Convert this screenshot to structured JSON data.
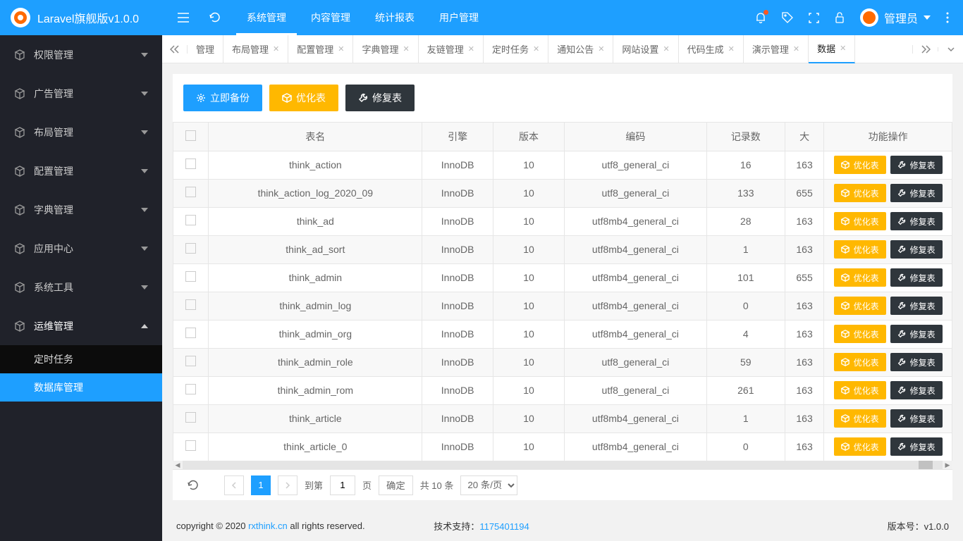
{
  "app": {
    "title": "Laravel旗舰版v1.0.0"
  },
  "topnav": [
    "系统管理",
    "内容管理",
    "统计报表",
    "用户管理"
  ],
  "topnav_active": 0,
  "header_user": {
    "name": "管理员"
  },
  "sidebar": {
    "items": [
      {
        "label": "权限管理",
        "open": false
      },
      {
        "label": "广告管理",
        "open": false
      },
      {
        "label": "布局管理",
        "open": false
      },
      {
        "label": "配置管理",
        "open": false
      },
      {
        "label": "字典管理",
        "open": false
      },
      {
        "label": "应用中心",
        "open": false
      },
      {
        "label": "系统工具",
        "open": false
      },
      {
        "label": "运维管理",
        "open": true,
        "children": [
          {
            "label": "定时任务",
            "active": false
          },
          {
            "label": "数据库管理",
            "active": true
          }
        ]
      }
    ]
  },
  "tabs": {
    "items": [
      "管理",
      "布局管理",
      "配置管理",
      "字典管理",
      "友链管理",
      "定时任务",
      "通知公告",
      "网站设置",
      "代码生成",
      "演示管理",
      "数据"
    ],
    "active": 10
  },
  "toolbar": {
    "backup": "立即备份",
    "optimize": "优化表",
    "repair": "修复表"
  },
  "table": {
    "headers": [
      "表名",
      "引擎",
      "版本",
      "编码",
      "记录数",
      "大",
      "功能操作"
    ],
    "optimize_label": "优化表",
    "repair_label": "修复表",
    "rows": [
      {
        "name": "think_action",
        "engine": "InnoDB",
        "ver": "10",
        "charset": "utf8_general_ci",
        "rows": "16",
        "size": "163"
      },
      {
        "name": "think_action_log_2020_09",
        "engine": "InnoDB",
        "ver": "10",
        "charset": "utf8_general_ci",
        "rows": "133",
        "size": "655"
      },
      {
        "name": "think_ad",
        "engine": "InnoDB",
        "ver": "10",
        "charset": "utf8mb4_general_ci",
        "rows": "28",
        "size": "163"
      },
      {
        "name": "think_ad_sort",
        "engine": "InnoDB",
        "ver": "10",
        "charset": "utf8mb4_general_ci",
        "rows": "1",
        "size": "163"
      },
      {
        "name": "think_admin",
        "engine": "InnoDB",
        "ver": "10",
        "charset": "utf8mb4_general_ci",
        "rows": "101",
        "size": "655"
      },
      {
        "name": "think_admin_log",
        "engine": "InnoDB",
        "ver": "10",
        "charset": "utf8mb4_general_ci",
        "rows": "0",
        "size": "163"
      },
      {
        "name": "think_admin_org",
        "engine": "InnoDB",
        "ver": "10",
        "charset": "utf8mb4_general_ci",
        "rows": "4",
        "size": "163"
      },
      {
        "name": "think_admin_role",
        "engine": "InnoDB",
        "ver": "10",
        "charset": "utf8_general_ci",
        "rows": "59",
        "size": "163"
      },
      {
        "name": "think_admin_rom",
        "engine": "InnoDB",
        "ver": "10",
        "charset": "utf8_general_ci",
        "rows": "261",
        "size": "163"
      },
      {
        "name": "think_article",
        "engine": "InnoDB",
        "ver": "10",
        "charset": "utf8mb4_general_ci",
        "rows": "1",
        "size": "163"
      },
      {
        "name": "think_article_0",
        "engine": "InnoDB",
        "ver": "10",
        "charset": "utf8mb4_general_ci",
        "rows": "0",
        "size": "163"
      }
    ]
  },
  "pagination": {
    "goto_label": "到第",
    "page_label": "页",
    "confirm": "确定",
    "total_label": "共 10 条",
    "per_page": "20 条/页",
    "current": "1"
  },
  "footer": {
    "copy_prefix": "copyright © 2020 ",
    "copy_link": "rxthink.cn",
    "copy_suffix": " all rights reserved.",
    "support_label": "技术支持：",
    "support_num": "1175401194",
    "version_label": "版本号：",
    "version": "v1.0.0"
  }
}
